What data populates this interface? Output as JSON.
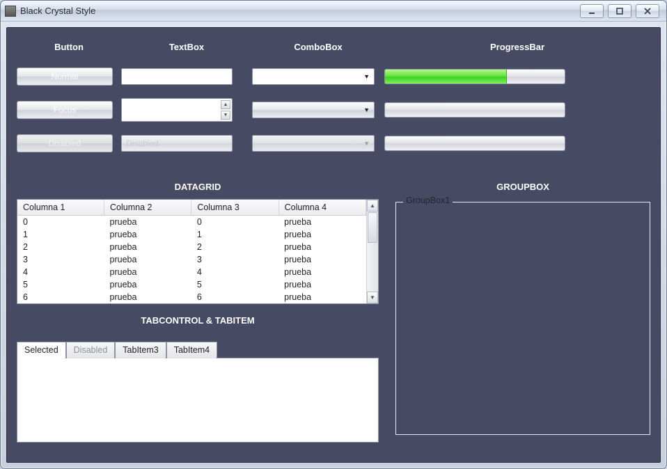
{
  "window": {
    "title": "Black Crystal Style"
  },
  "headers": {
    "button": "Button",
    "textbox": "TextBox",
    "combobox": "ComboBox",
    "progressbar": "ProgressBar"
  },
  "buttons": {
    "normal": "Normal",
    "focus": "Focus",
    "disabled": "Disabled"
  },
  "textboxes": {
    "normal": "",
    "multiline": "",
    "disabled_placeholder": "Disabled"
  },
  "progress": {
    "value_pct": 68
  },
  "sections": {
    "datagrid": "DATAGRID",
    "groupbox": "GROUPBOX",
    "tabcontrol": "TABCONTROL & TABITEM"
  },
  "datagrid": {
    "columns": [
      "Columna 1",
      "Columna 2",
      "Columna 3",
      "Columna 4"
    ],
    "rows": [
      [
        "0",
        "prueba",
        "0",
        "prueba"
      ],
      [
        "1",
        "prueba",
        "1",
        "prueba"
      ],
      [
        "2",
        "prueba",
        "2",
        "prueba"
      ],
      [
        "3",
        "prueba",
        "3",
        "prueba"
      ],
      [
        "4",
        "prueba",
        "4",
        "prueba"
      ],
      [
        "5",
        "prueba",
        "5",
        "prueba"
      ],
      [
        "6",
        "prueba",
        "6",
        "prueba"
      ]
    ]
  },
  "tabs": {
    "selected": "Selected",
    "disabled": "Disabled",
    "item3": "TabItem3",
    "item4": "TabItem4"
  },
  "groupbox": {
    "legend": "GroupBox1"
  }
}
